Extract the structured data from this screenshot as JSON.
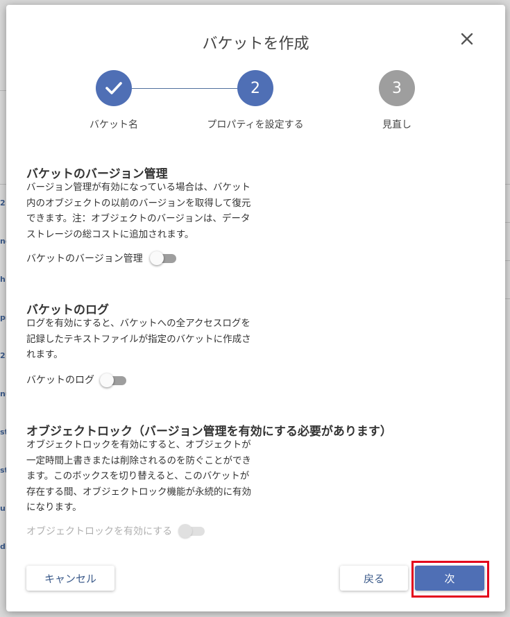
{
  "dialog": {
    "title": "バケットを作成"
  },
  "stepper": {
    "steps": [
      {
        "label": "バケット名",
        "status": "completed",
        "number": ""
      },
      {
        "label": "プロパティを設定する",
        "status": "current",
        "number": "2"
      },
      {
        "label": "見直し",
        "status": "upcoming",
        "number": "3"
      }
    ]
  },
  "versioning": {
    "title": "バケットのバージョン管理",
    "description": "バージョン管理が有効になっている場合は、バケット内のオブジェクトの以前のバージョンを取得して復元できます。注：オブジェクトのバージョンは、データストレージの総コストに追加されます。",
    "toggle_label": "バケットのバージョン管理",
    "enabled": false
  },
  "logging": {
    "title": "バケットのログ",
    "description": "ログを有効にすると、バケットへの全アクセスログを記録したテキストファイルが指定のバケットに作成されます。",
    "toggle_label": "バケットのログ",
    "enabled": false
  },
  "object_lock": {
    "title": "オブジェクトロック（バージョン管理を有効にする必要があります）",
    "description": "オブジェクトロックを有効にすると、オブジェクトが一定時間上書きまたは削除されるのを防ぐことができます。このボックスを切り替えると、このバケットが存在する間、オブジェクトロック機能が永続的に有効になります。",
    "toggle_label": "オブジェクトロックを有効にする",
    "enabled": false,
    "disabled": true
  },
  "footer": {
    "cancel_label": "キャンセル",
    "back_label": "戻る",
    "next_label": "次"
  },
  "background": {
    "left_fragments": [
      "2",
      "ne",
      "h:",
      "pr",
      "2",
      "nu",
      "st",
      "st",
      "u",
      "di"
    ]
  },
  "colors": {
    "accent": "#4f6fb5",
    "step_upcoming": "#9e9e9e",
    "highlight": "#e3001b"
  }
}
